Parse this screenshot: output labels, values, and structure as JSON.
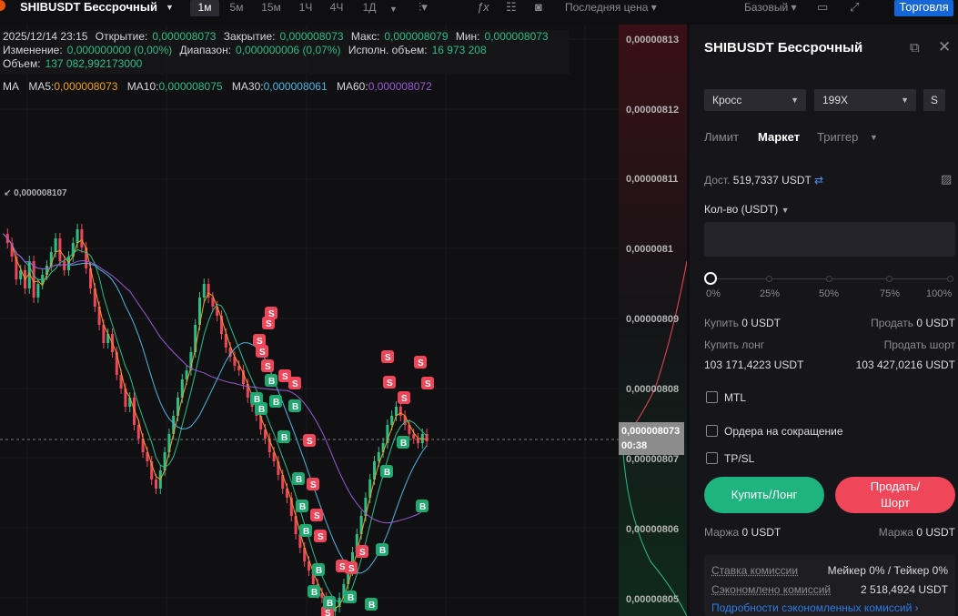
{
  "topbar": {
    "pair": "SHIBUSDT Бессрочный",
    "timeframes": [
      "1м",
      "5м",
      "15м",
      "1Ч",
      "4Ч",
      "1Д"
    ],
    "active_timeframe": "1м",
    "price_type": "Последняя цена ▾",
    "view": "Базовый ▾",
    "trade_button": "Торговля"
  },
  "legend": {
    "datetime": "2025/12/14 23:15",
    "open_label": "Открытие:",
    "open": "0,000008073",
    "close_label": "Закрытие:",
    "close": "0,000008073",
    "high_label": "Макс:",
    "high": "0,000008079",
    "low_label": "Мин:",
    "low": "0,000008073",
    "change_label": "Изменение:",
    "change": "0,000000000 (0,00%)",
    "range_label": "Диапазон:",
    "range": "0,000000006 (0,07%)",
    "exec_label": "Исполн. объем:",
    "exec": "16 973 208",
    "volume_label": "Объем:",
    "volume": "137 082,992173000"
  },
  "ma": {
    "label": "MA",
    "items": [
      {
        "name": "MA5:",
        "value": "0,000008073",
        "color": "#f0a020"
      },
      {
        "name": "MA10:",
        "value": "0,000008075",
        "color": "#2ebd85"
      },
      {
        "name": "MA30:",
        "value": "0,000008061",
        "color": "#4fb6e0"
      },
      {
        "name": "MA60:",
        "value": "0,000008072",
        "color": "#9b59d6"
      }
    ]
  },
  "axis": {
    "ticks": [
      "0,00000813",
      "0,00000812",
      "0,00000811",
      "0,0000081",
      "0,00000809",
      "0,00000808",
      "0,00000807",
      "0,00000806",
      "0,00000805"
    ],
    "current_price": "0,000008073",
    "countdown": "00:38",
    "high_marker": "0,000008107"
  },
  "panel": {
    "title": "SHIBUSDT Бессрочный",
    "margin_mode": "Кросс",
    "leverage": "199X",
    "s_button": "S",
    "tabs": [
      "Лимит",
      "Маркет",
      "Триггер"
    ],
    "active_tab": "Маркет",
    "available_label": "Дост.",
    "available_value": "519,7337 USDT",
    "qty_label": "Кол-во (USDT)",
    "slider_labels": [
      "0%",
      "25%",
      "50%",
      "75%",
      "100%"
    ],
    "buy_label": "Купить",
    "buy_value": "0 USDT",
    "sell_label": "Продать",
    "sell_value": "0 USDT",
    "buy_long_label": "Купить лонг",
    "sell_short_label": "Продать шорт",
    "buy_long_value": "103 171,4223 USDT",
    "sell_short_value": "103 427,0216 USDT",
    "mtl": "MTL",
    "reduce_only": "Ордера на сокращение",
    "tpsl": "TP/SL",
    "buy_button": "Купить/Лонг",
    "sell_button_1": "Продать/",
    "sell_button_2": "Шорт",
    "margin_label": "Маржа",
    "margin_buy": "0 USDT",
    "margin_sell": "0 USDT",
    "fee_label": "Ставка комиссии",
    "fee_value": "Мейкер 0% / Тейкер 0%",
    "saved_label": "Сэкономлено комиссий",
    "saved_value": "2 518,4924 USDT",
    "saved_link": "Подробности сэкономленных комиссий ›"
  },
  "colors": {
    "up": "#2ebd85",
    "down": "#f0465a",
    "accent": "#1566d6"
  }
}
